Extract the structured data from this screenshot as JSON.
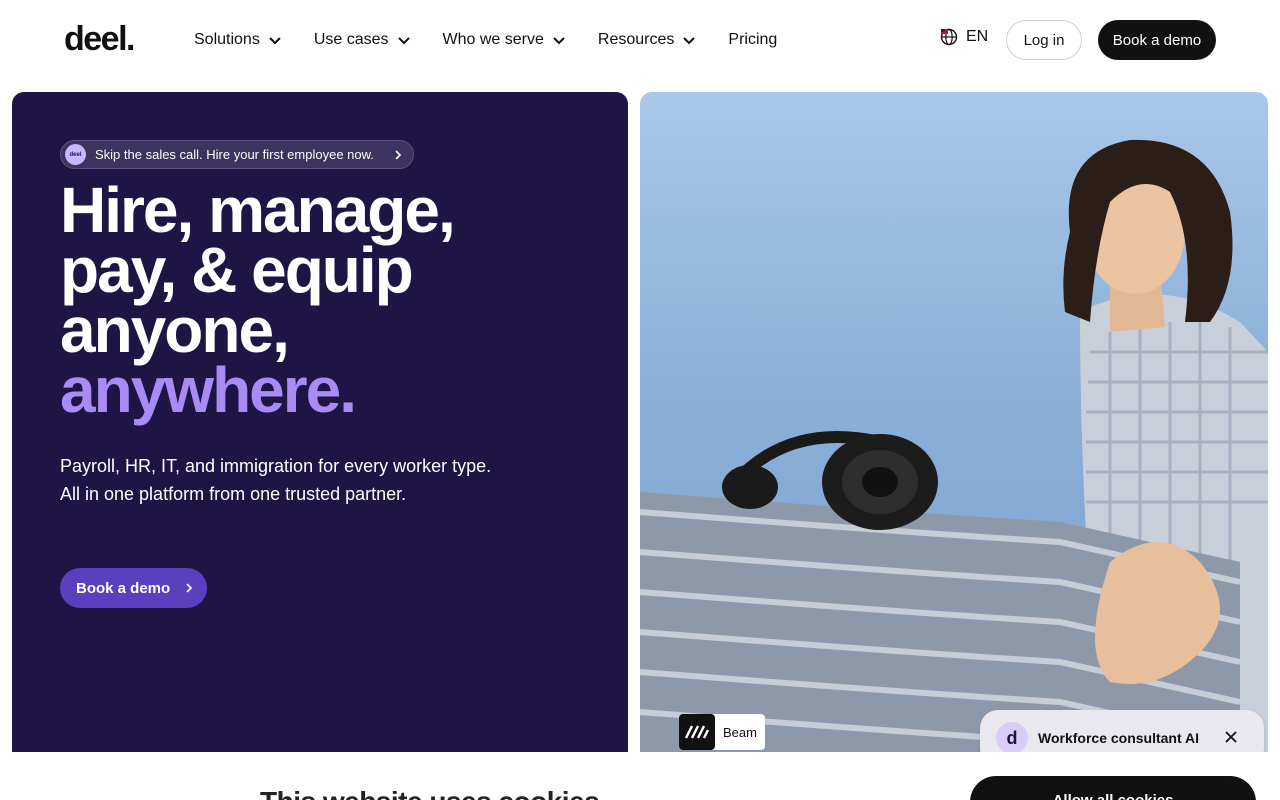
{
  "nav": {
    "logo": "deel.",
    "items": [
      {
        "label": "Solutions",
        "has_dropdown": true
      },
      {
        "label": "Use cases",
        "has_dropdown": true
      },
      {
        "label": "Who we serve",
        "has_dropdown": true
      },
      {
        "label": "Resources",
        "has_dropdown": true
      },
      {
        "label": "Pricing",
        "has_dropdown": false
      }
    ],
    "language": "EN",
    "login_label": "Log in",
    "demo_label": "Book a demo"
  },
  "hero": {
    "pill_logo": "deel",
    "pill_text": "Skip the sales call. Hire your first employee now.",
    "headline_lines": [
      "Hire, manage,",
      "pay, & equip",
      "anyone,"
    ],
    "headline_accent": "anywhere.",
    "subtext_line1": "Payroll, HR, IT, and immigration for every worker type.",
    "subtext_line2": "All in one platform from one trusted partner.",
    "cta_label": "Book a demo",
    "customer_label": "Beam"
  },
  "chat": {
    "avatar_letter": "d",
    "label": "Workforce consultant AI"
  },
  "cookie": {
    "title": "This website uses cookies",
    "allow_label": "Allow all cookies"
  },
  "colors": {
    "hero_bg": "#1f1545",
    "accent": "#a98bf5",
    "cta": "#5a3fbf"
  }
}
